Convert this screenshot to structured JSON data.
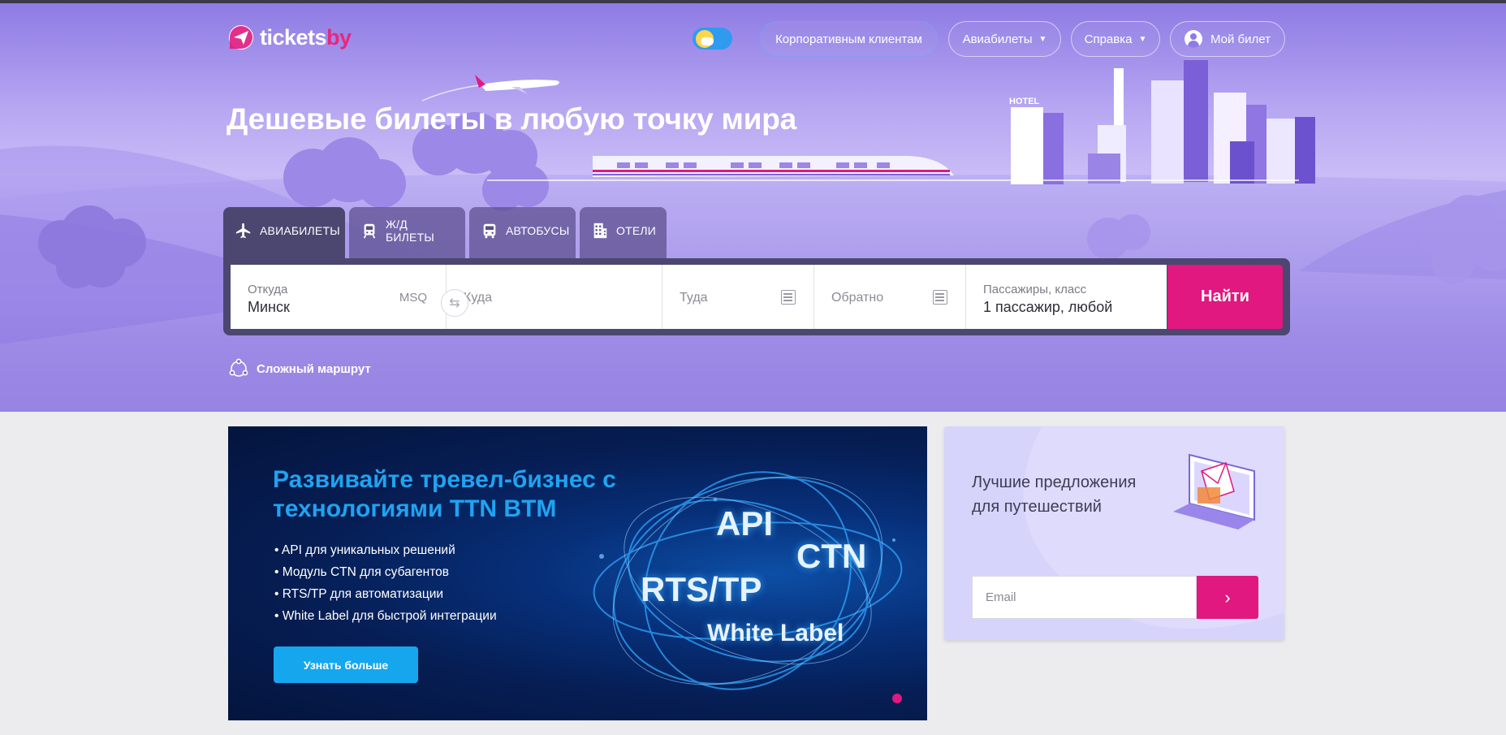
{
  "header": {
    "logo_main": "tickets",
    "logo_suffix": "by",
    "nav": {
      "corporate": "Корпоративным клиентам",
      "air": "Авиабилеты",
      "help": "Справка",
      "my_ticket": "Мой билет"
    }
  },
  "hero": {
    "title": "Дешевые билеты в любую точку мира",
    "hotel_sign": "HOTEL"
  },
  "tabs": [
    {
      "label": "АВИАБИЛЕТЫ",
      "icon": "plane-icon",
      "active": true
    },
    {
      "label": "Ж/Д БИЛЕТЫ",
      "icon": "train-icon",
      "active": false
    },
    {
      "label": "АВТОБУСЫ",
      "icon": "bus-icon",
      "active": false
    },
    {
      "label": "ОТЕЛИ",
      "icon": "hotel-icon",
      "active": false
    }
  ],
  "search": {
    "from_label": "Откуда",
    "from_value": "Минск",
    "from_code": "MSQ",
    "to_placeholder": "Куда",
    "there_placeholder": "Туда",
    "back_placeholder": "Обратно",
    "pax_label": "Пассажиры, класс",
    "pax_value": "1 пассажир, любой",
    "submit": "Найти"
  },
  "complex_route": "Сложный маршрут",
  "banner": {
    "title": "Развивайте тревел-бизнес с технологиями TTN BTM",
    "items": [
      "API для уникальных решений",
      "Модуль CTN для субагентов",
      "RTS/TP для автоматизации",
      "White Label для быстрой интеграции"
    ],
    "button": "Узнать больше",
    "glow": {
      "api": "API",
      "ctn": "CTN",
      "rts": "RTS/TP",
      "white": "White Label"
    }
  },
  "subscribe": {
    "text": "Лучшие предложения для путешествий",
    "email_placeholder": "Email"
  },
  "colors": {
    "accent": "#e0187f",
    "tab_bar": "#4b4770",
    "banner_button": "#16a6ee"
  }
}
